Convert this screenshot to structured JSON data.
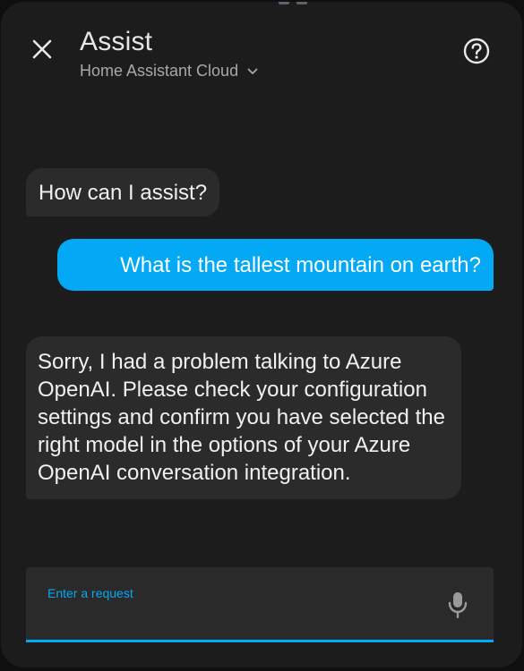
{
  "header": {
    "title": "Assist",
    "subtitle": "Home Assistant Cloud",
    "close_icon": "close-icon",
    "help_icon": "help-circle-icon",
    "dropdown_icon": "chevron-down-icon"
  },
  "conversation": {
    "messages": [
      {
        "sender": "assistant",
        "text": "How can I assist?"
      },
      {
        "sender": "user",
        "text": "What is the tallest mountain on earth?"
      },
      {
        "sender": "assistant",
        "text": "Sorry, I had a problem talking to Azure OpenAI. Please check your configuration settings and confirm you have selected the right model in the options of your Azure OpenAI conversation integration."
      }
    ]
  },
  "input": {
    "label": "Enter a request",
    "value": "",
    "mic_icon": "microphone-icon"
  },
  "colors": {
    "accent": "#03a9f4",
    "background": "#1c1c1c",
    "bubble": "#2b2b2b"
  }
}
